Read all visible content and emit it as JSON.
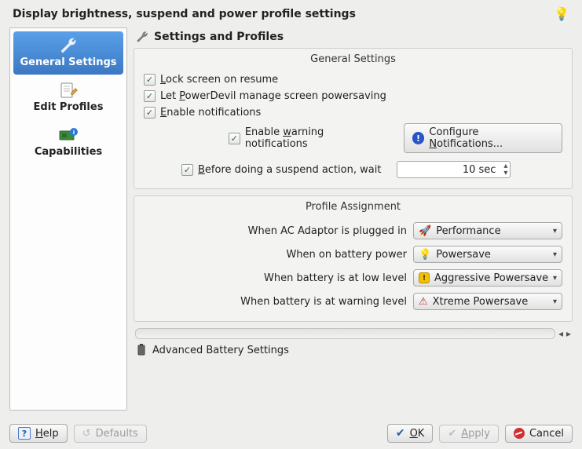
{
  "header": {
    "title": "Display brightness, suspend and power profile settings"
  },
  "sidebar": {
    "items": [
      {
        "label": "General Settings"
      },
      {
        "label": "Edit Profiles"
      },
      {
        "label": "Capabilities"
      }
    ]
  },
  "main": {
    "section_title": "Settings and Profiles",
    "general": {
      "title": "General Settings",
      "lock_label": "Lock screen on resume",
      "powerdevil_label": "Let PowerDevil manage screen powersaving",
      "notif_label": "Enable notifications",
      "warn_label": "Enable warning notifications",
      "configure_btn": "Configure Notifications...",
      "suspend_label": "Before doing a suspend action, wait",
      "suspend_value": "10 sec"
    },
    "profile": {
      "title": "Profile Assignment",
      "rows": [
        {
          "label": "When AC Adaptor is plugged in",
          "value": "Performance"
        },
        {
          "label": "When on battery power",
          "value": "Powersave"
        },
        {
          "label": "When battery is at low level",
          "value": "Aggressive Powersave"
        },
        {
          "label": "When battery is at warning level",
          "value": "Xtreme Powersave"
        }
      ]
    },
    "advanced_label": "Advanced Battery Settings"
  },
  "footer": {
    "help": "Help",
    "defaults": "Defaults",
    "ok": "OK",
    "apply": "Apply",
    "cancel": "Cancel"
  }
}
